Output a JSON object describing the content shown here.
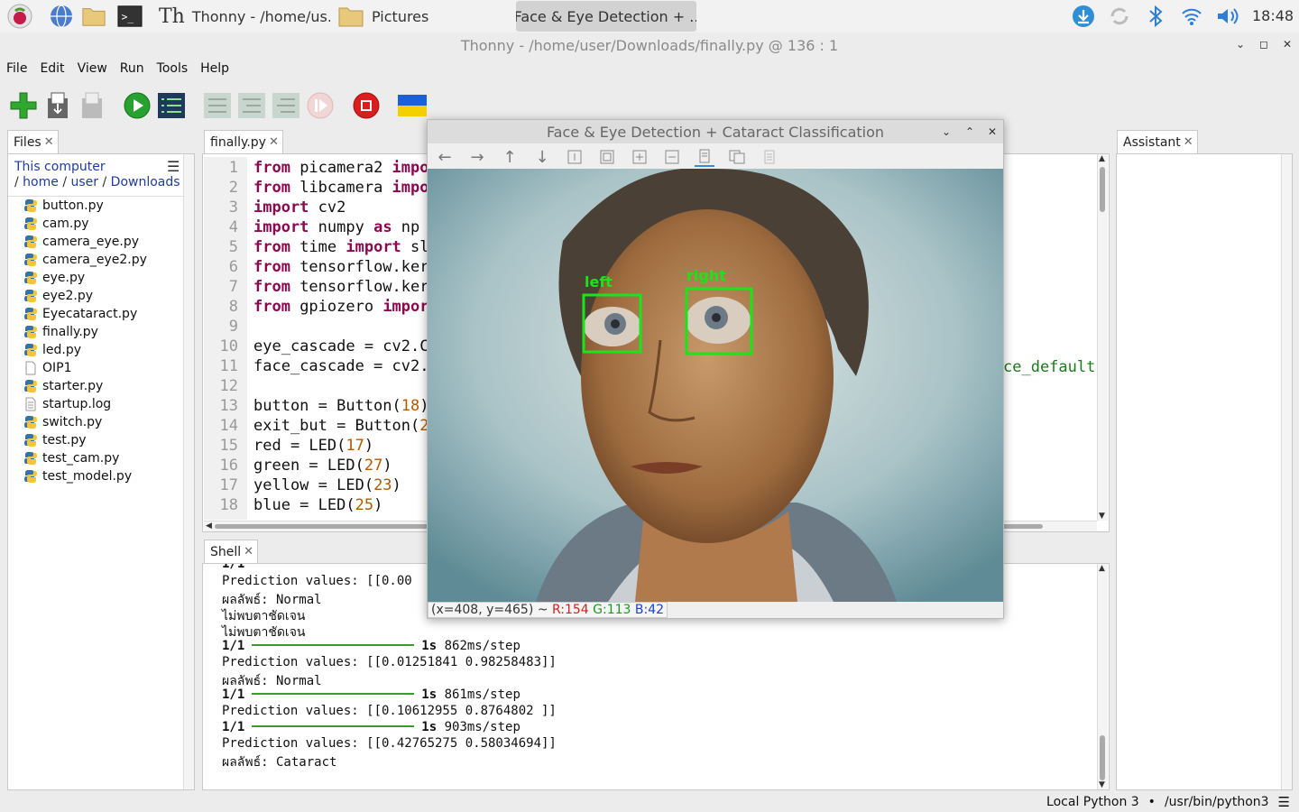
{
  "taskbar": {
    "apps": [
      {
        "label": "Thonny  -  /home/us.."
      },
      {
        "label": "Pictures"
      }
    ],
    "active_window": "Face & Eye Detection + ..",
    "clock": "18:48"
  },
  "window": {
    "title": "Thonny  -  /home/user/Downloads/finally.py  @  136 : 1"
  },
  "menu": [
    "File",
    "Edit",
    "View",
    "Run",
    "Tools",
    "Help"
  ],
  "files_panel": {
    "tab": "Files",
    "location": "This computer",
    "path": [
      "home",
      "user",
      "Downloads"
    ],
    "items": [
      {
        "name": "button.py",
        "icon": "python-file-icon"
      },
      {
        "name": "cam.py",
        "icon": "python-file-icon"
      },
      {
        "name": "camera_eye.py",
        "icon": "python-file-icon"
      },
      {
        "name": "camera_eye2.py",
        "icon": "python-file-icon"
      },
      {
        "name": "eye.py",
        "icon": "python-file-icon"
      },
      {
        "name": "eye2.py",
        "icon": "python-file-icon"
      },
      {
        "name": "Eyecataract.py",
        "icon": "python-file-icon"
      },
      {
        "name": "finally.py",
        "icon": "python-file-icon"
      },
      {
        "name": "led.py",
        "icon": "python-file-icon"
      },
      {
        "name": "OIP1",
        "icon": "blank-file-icon"
      },
      {
        "name": "starter.py",
        "icon": "python-file-icon"
      },
      {
        "name": "startup.log",
        "icon": "text-file-icon"
      },
      {
        "name": "switch.py",
        "icon": "python-file-icon"
      },
      {
        "name": "test.py",
        "icon": "python-file-icon"
      },
      {
        "name": "test_cam.py",
        "icon": "python-file-icon"
      },
      {
        "name": "test_model.py",
        "icon": "python-file-icon"
      }
    ]
  },
  "editor": {
    "tab": "finally.py",
    "lines": [
      {
        "n": "1",
        "parts": [
          [
            "kw",
            "from"
          ],
          [
            "t",
            " picamera2 "
          ],
          [
            "kw",
            "impo"
          ]
        ]
      },
      {
        "n": "2",
        "parts": [
          [
            "kw",
            "from"
          ],
          [
            "t",
            " libcamera "
          ],
          [
            "kw",
            "impo"
          ]
        ]
      },
      {
        "n": "3",
        "parts": [
          [
            "kw",
            "import"
          ],
          [
            "t",
            " cv2"
          ]
        ]
      },
      {
        "n": "4",
        "parts": [
          [
            "kw",
            "import"
          ],
          [
            "t",
            " numpy "
          ],
          [
            "kw",
            "as"
          ],
          [
            "t",
            " np"
          ]
        ]
      },
      {
        "n": "5",
        "parts": [
          [
            "kw",
            "from"
          ],
          [
            "t",
            " time "
          ],
          [
            "kw",
            "import"
          ],
          [
            "t",
            " sl"
          ]
        ]
      },
      {
        "n": "6",
        "parts": [
          [
            "kw",
            "from"
          ],
          [
            "t",
            " tensorflow.ker"
          ]
        ]
      },
      {
        "n": "7",
        "parts": [
          [
            "kw",
            "from"
          ],
          [
            "t",
            " tensorflow.ker"
          ]
        ]
      },
      {
        "n": "8",
        "parts": [
          [
            "kw",
            "from"
          ],
          [
            "t",
            " gpiozero "
          ],
          [
            "kw",
            "impor"
          ]
        ]
      },
      {
        "n": "9",
        "parts": []
      },
      {
        "n": "10",
        "parts": [
          [
            "t",
            "eye_cascade = cv2.C"
          ]
        ]
      },
      {
        "n": "11",
        "parts": [
          [
            "t",
            "face_cascade = cv2."
          ]
        ]
      },
      {
        "n": "12",
        "parts": []
      },
      {
        "n": "13",
        "parts": [
          [
            "t",
            "button = Button("
          ],
          [
            "num",
            "18"
          ],
          [
            "t",
            ")"
          ]
        ]
      },
      {
        "n": "14",
        "parts": [
          [
            "t",
            "exit_but = Button("
          ],
          [
            "num",
            "2"
          ]
        ]
      },
      {
        "n": "15",
        "parts": [
          [
            "t",
            "red = LED("
          ],
          [
            "num",
            "17"
          ],
          [
            "t",
            ")"
          ]
        ]
      },
      {
        "n": "16",
        "parts": [
          [
            "t",
            "green = LED("
          ],
          [
            "num",
            "27"
          ],
          [
            "t",
            ")"
          ]
        ]
      },
      {
        "n": "17",
        "parts": [
          [
            "t",
            "yellow = LED("
          ],
          [
            "num",
            "23"
          ],
          [
            "t",
            ")"
          ]
        ]
      },
      {
        "n": "18",
        "parts": [
          [
            "t",
            "blue = LED("
          ],
          [
            "num",
            "25"
          ],
          [
            "t",
            ")"
          ]
        ]
      }
    ],
    "line11_tail": "ce_default"
  },
  "shell": {
    "tab": "Shell",
    "lines": [
      {
        "type": "text",
        "text": "Prediction values: [[0.00"
      },
      {
        "type": "text",
        "text": "ผลลัพธ์: Normal"
      },
      {
        "type": "text",
        "text": "ไม่พบตาชัดเจน"
      },
      {
        "type": "text",
        "text": "ไม่พบตาชัดเจน"
      },
      {
        "type": "progress",
        "step": "1/1",
        "time": "1s",
        "rate": "862ms/step"
      },
      {
        "type": "text",
        "text": "Prediction values: [[0.01251841 0.98258483]]"
      },
      {
        "type": "text",
        "text": "ผลลัพธ์: Normal"
      },
      {
        "type": "progress",
        "step": "1/1",
        "time": "1s",
        "rate": "861ms/step"
      },
      {
        "type": "text",
        "text": "Prediction values: [[0.10612955 0.8764802 ]]"
      },
      {
        "type": "progress",
        "step": "1/1",
        "time": "1s",
        "rate": "903ms/step"
      },
      {
        "type": "text",
        "text": "Prediction values: [[0.42765275 0.58034694]]"
      },
      {
        "type": "text",
        "text": "ผลลัพธ์: Cataract"
      }
    ],
    "partial_top": "1/1"
  },
  "assistant_panel": {
    "tab": "Assistant"
  },
  "image_window": {
    "title": "Face & Eye Detection + Cataract Classification",
    "eye_labels": {
      "left": "left",
      "right": "right"
    },
    "pixel_readout": {
      "coords": "(x=408, y=465) ~",
      "r": "R:154",
      "g": "G:113",
      "b": "B:42"
    }
  },
  "statusbar": {
    "interpreter": "Local Python 3",
    "separator": "•",
    "path": "/usr/bin/python3"
  },
  "colors": {
    "keyword": "#8b0a4f",
    "number": "#b35a00",
    "detection_box": "#19e619",
    "progress": "#3a9b2e"
  }
}
